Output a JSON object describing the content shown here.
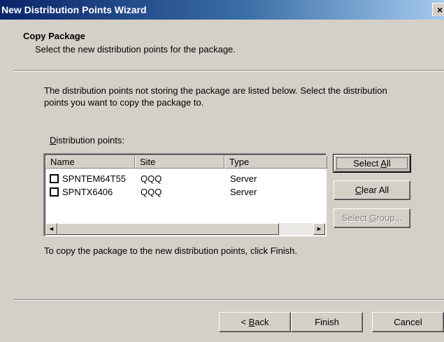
{
  "window": {
    "title": "New Distribution Points Wizard",
    "close_glyph": "×"
  },
  "header": {
    "title": "Copy Package",
    "subtitle": "Select the new distribution points for the package."
  },
  "intro_text": "The distribution points not storing the package are listed below. Select the distribution points you want to copy the package to.",
  "list_label": {
    "prefix": "",
    "mnemonic": "D",
    "rest": "istribution points:"
  },
  "list": {
    "columns": [
      "Name",
      "Site",
      "Type"
    ],
    "rows": [
      {
        "name": "SPNTEM64T55",
        "site": "QQQ",
        "type": "Server",
        "checked": false
      },
      {
        "name": "SPNTX6406",
        "site": "QQQ",
        "type": "Server",
        "checked": false
      }
    ],
    "scroll_left_icon": "◄",
    "scroll_right_icon": "►"
  },
  "buttons": {
    "select_all": {
      "prefix": "Select ",
      "mnemonic": "A",
      "rest": "ll"
    },
    "clear_all": {
      "prefix": "",
      "mnemonic": "C",
      "rest": "lear All"
    },
    "select_group": {
      "prefix": "Select ",
      "mnemonic": "G",
      "rest": "roup..."
    },
    "back": {
      "prefix": "< ",
      "mnemonic": "B",
      "rest": "ack"
    },
    "finish": "Finish",
    "cancel": "Cancel"
  },
  "finish_instruction": "To copy the package to the new distribution points, click Finish."
}
